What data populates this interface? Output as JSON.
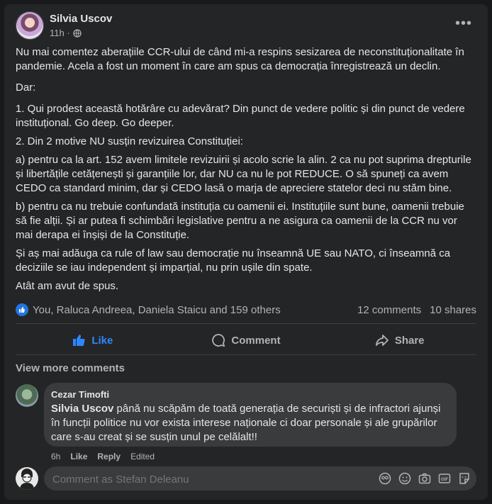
{
  "post": {
    "author": "Silvia Uscov",
    "time": "11h ·",
    "paragraphs": [
      "Nu mai comentez aberațiile CCR-ului de când mi-a respins sesizarea de neconstituționalitate în pandemie. Acela a fost un moment în care am spus ca democrația înregistrează un declin.",
      "Dar:",
      "1. Qui prodest această hotărâre cu adevărat? Din punct de vedere politic și din punct de vedere instituțional. Go deep. Go deeper.",
      "2. Din 2 motive NU susțin revizuirea Constituției:",
      "a) pentru ca la art. 152 avem limitele revizuirii și acolo scrie la alin. 2 ca nu pot suprima drepturile și libertățile cetățenești și garanțiile lor, dar NU ca nu le pot REDUCE. O să spuneți ca avem CEDO ca standard minim, dar și CEDO lasă o marja de apreciere statelor deci nu stăm bine.",
      "b) pentru ca nu trebuie confundată instituția cu oamenii ei. Instituțiile sunt bune, oamenii trebuie să fie alții. Și ar putea fi schimbări legislative pentru a ne asigura ca oamenii de la CCR nu vor mai derapa ei înșiși de la Constituție.",
      "Și aș mai adăuga ca rule of law sau democrație nu înseamnă UE sau NATO, ci înseamnă ca deciziile se iau independent și imparțial, nu prin ușile din spate.",
      "Atât am avut de spus."
    ]
  },
  "stats": {
    "likers": "You, Raluca Andreea, Daniela Staicu and 159 others",
    "comments": "12 comments",
    "shares": "10 shares"
  },
  "actions": {
    "like": "Like",
    "comment": "Comment",
    "share": "Share"
  },
  "view_more": "View more comments",
  "comment": {
    "author": "Cezar Timofti",
    "mention": "Silvia Uscov",
    "text": " până nu scăpăm de toată generația de securiști și de infractori ajunși în funcții politice nu vor exista interese naționale ci doar personale și ale grupărilor care s-au creat și se susțin unul pe celălalt!!",
    "time": "6h",
    "like": "Like",
    "reply": "Reply",
    "edited": "Edited"
  },
  "composer": {
    "placeholder": "Comment as Stefan Deleanu"
  },
  "colors": {
    "accent": "#2d88ff",
    "card": "#242526",
    "bubble": "#3a3b3c"
  },
  "icons": [
    "globe-icon",
    "more-icon",
    "like-badge-icon",
    "like-icon",
    "comment-icon",
    "share-icon",
    "avatar-sticker-icon",
    "emoji-icon",
    "camera-icon",
    "gif-icon",
    "sticker-icon"
  ]
}
